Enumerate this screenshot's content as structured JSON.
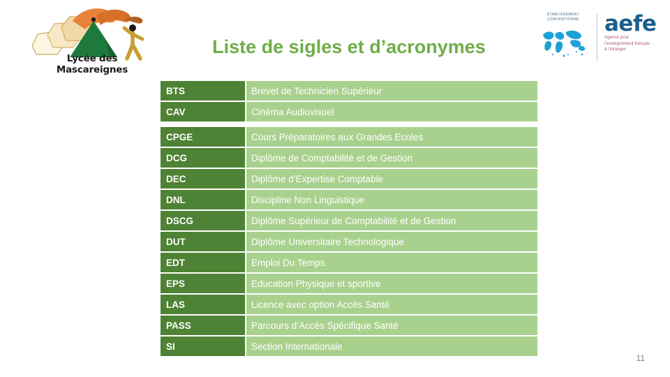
{
  "header": {
    "title": "Liste de sigles et d’acronymes",
    "school_logo": {
      "name": "Lycée des Mascareignes",
      "icon": "mountain-book-runner-logo"
    },
    "aefe_logo": {
      "certification_line1": "ÉTABLISSEMENT",
      "certification_line2": "CONVENTIONNÉ",
      "globe_icon": "world-map-icon",
      "wordmark": "aefe",
      "tagline_line1": "Agence pour",
      "tagline_line2": "l’enseignement français",
      "tagline_line3": "à l’étranger"
    }
  },
  "table": {
    "rows": [
      {
        "code": "BTS",
        "label": "Brevet de Technicien Supérieur"
      },
      {
        "code": "CAV",
        "label": "Cinéma Audiovisuel"
      },
      {
        "code": "CPGE",
        "label": "Cours Préparatoires aux Grandes Ecoles"
      },
      {
        "code": "DCG",
        "label": "Diplôme de Comptabilité et de Gestion"
      },
      {
        "code": "DEC",
        "label": "Diplôme d’Expertise Comptable"
      },
      {
        "code": "DNL",
        "label": "Discipline Non Linguistique"
      },
      {
        "code": "DSCG",
        "label": "Diplôme Supérieur de Comptabilité et de Gestion"
      },
      {
        "code": "DUT",
        "label": "Diplôme Universitaire Technologique"
      },
      {
        "code": "EDT",
        "label": "Emploi Du Temps"
      },
      {
        "code": "EPS",
        "label": "Education  Physique et sportive"
      },
      {
        "code": "LAS",
        "label": "Licence avec option Accès Santé"
      },
      {
        "code": "PASS",
        "label": "Parcours d’Accès Spécifique Santé"
      },
      {
        "code": "SI",
        "label": "Section Internationale"
      }
    ]
  },
  "footer": {
    "page_number": "11"
  },
  "colors": {
    "title_green": "#70AD47",
    "code_cell_green": "#4E8234",
    "label_cell_green": "#A9D18E",
    "aefe_blue": "#1B5F8C",
    "aefe_pink": "#B05A6A"
  }
}
